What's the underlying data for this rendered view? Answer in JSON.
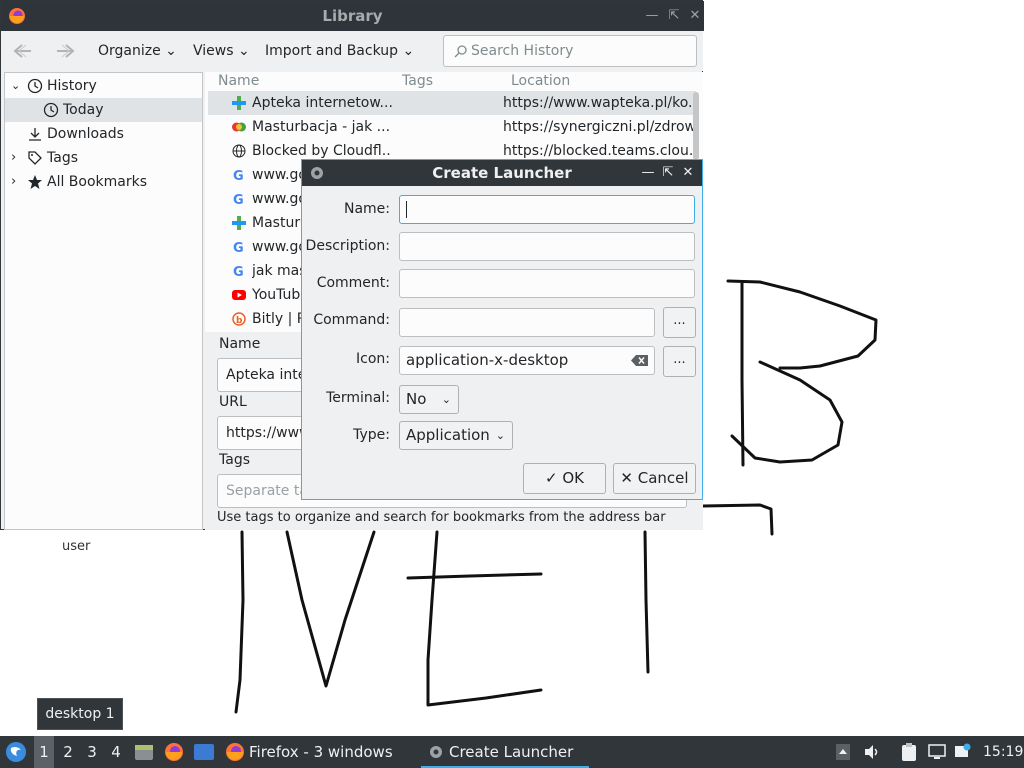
{
  "desktop": {
    "user_label": "user",
    "tooltip": "desktop 1"
  },
  "library": {
    "title": "Library",
    "toolbar": {
      "organize": "Organize",
      "views": "Views",
      "import_backup": "Import and Backup",
      "search_placeholder": "Search History"
    },
    "sidebar": {
      "items": [
        {
          "label": "History",
          "icon": "clock-icon"
        },
        {
          "label": "Today",
          "icon": "clock-icon"
        },
        {
          "label": "Downloads",
          "icon": "download-icon"
        },
        {
          "label": "Tags",
          "icon": "tag-icon"
        },
        {
          "label": "All Bookmarks",
          "icon": "star-icon"
        }
      ]
    },
    "columns": {
      "name": "Name",
      "tags": "Tags",
      "location": "Location"
    },
    "rows": [
      {
        "name": "Apteka internetow...",
        "location": "https://www.wapteka.pl/ko...",
        "icon": "plus-icon"
      },
      {
        "name": "Masturbacja - jak ...",
        "location": "https://synergiczni.pl/zdrow...",
        "icon": "synergia-icon"
      },
      {
        "name": "Blocked by Cloudfl...",
        "location": "https://blocked.teams.clou...",
        "icon": "globe-icon"
      },
      {
        "name": "www.go",
        "location": "",
        "icon": "google-icon"
      },
      {
        "name": "www.go",
        "location": "",
        "icon": "google-icon"
      },
      {
        "name": "Masturb",
        "location": "",
        "icon": "plus-icon"
      },
      {
        "name": "www.go",
        "location": "",
        "icon": "google-icon"
      },
      {
        "name": "jak mas",
        "location": "",
        "icon": "google-icon"
      },
      {
        "name": "YouTube",
        "location": "",
        "icon": "youtube-icon"
      },
      {
        "name": "Bitly | P",
        "location": "",
        "icon": "bitly-icon"
      }
    ],
    "details": {
      "name_label": "Name",
      "name_value": "Apteka inte",
      "url_label": "URL",
      "url_value": "https://www",
      "tags_label": "Tags",
      "tags_placeholder": "Separate ta",
      "hint": "Use tags to organize and search for bookmarks from the address bar"
    }
  },
  "dialog": {
    "title": "Create Launcher",
    "name_label": "Name:",
    "name_value": "",
    "description_label": "Description:",
    "description_value": "",
    "comment_label": "Comment:",
    "comment_value": "",
    "command_label": "Command:",
    "command_value": "",
    "browse_label": "...",
    "icon_label": "Icon:",
    "icon_value": "application-x-desktop",
    "terminal_label": "Terminal:",
    "terminal_value": "No",
    "type_label": "Type:",
    "type_value": "Application",
    "ok_label": "OK",
    "cancel_label": "Cancel"
  },
  "taskbar": {
    "workspaces": [
      "1",
      "2",
      "3",
      "4"
    ],
    "active_workspace": "1",
    "tasks": [
      {
        "title": "Firefox - 3 windows",
        "icon": "firefox-icon"
      },
      {
        "title": "Create Launcher",
        "icon": "gear-icon"
      }
    ],
    "clock": "15:19"
  },
  "colors": {
    "accent": "#3daee9",
    "titlebar": "#31363b",
    "panel": "#31363b",
    "window_bg": "#eff0f1"
  }
}
